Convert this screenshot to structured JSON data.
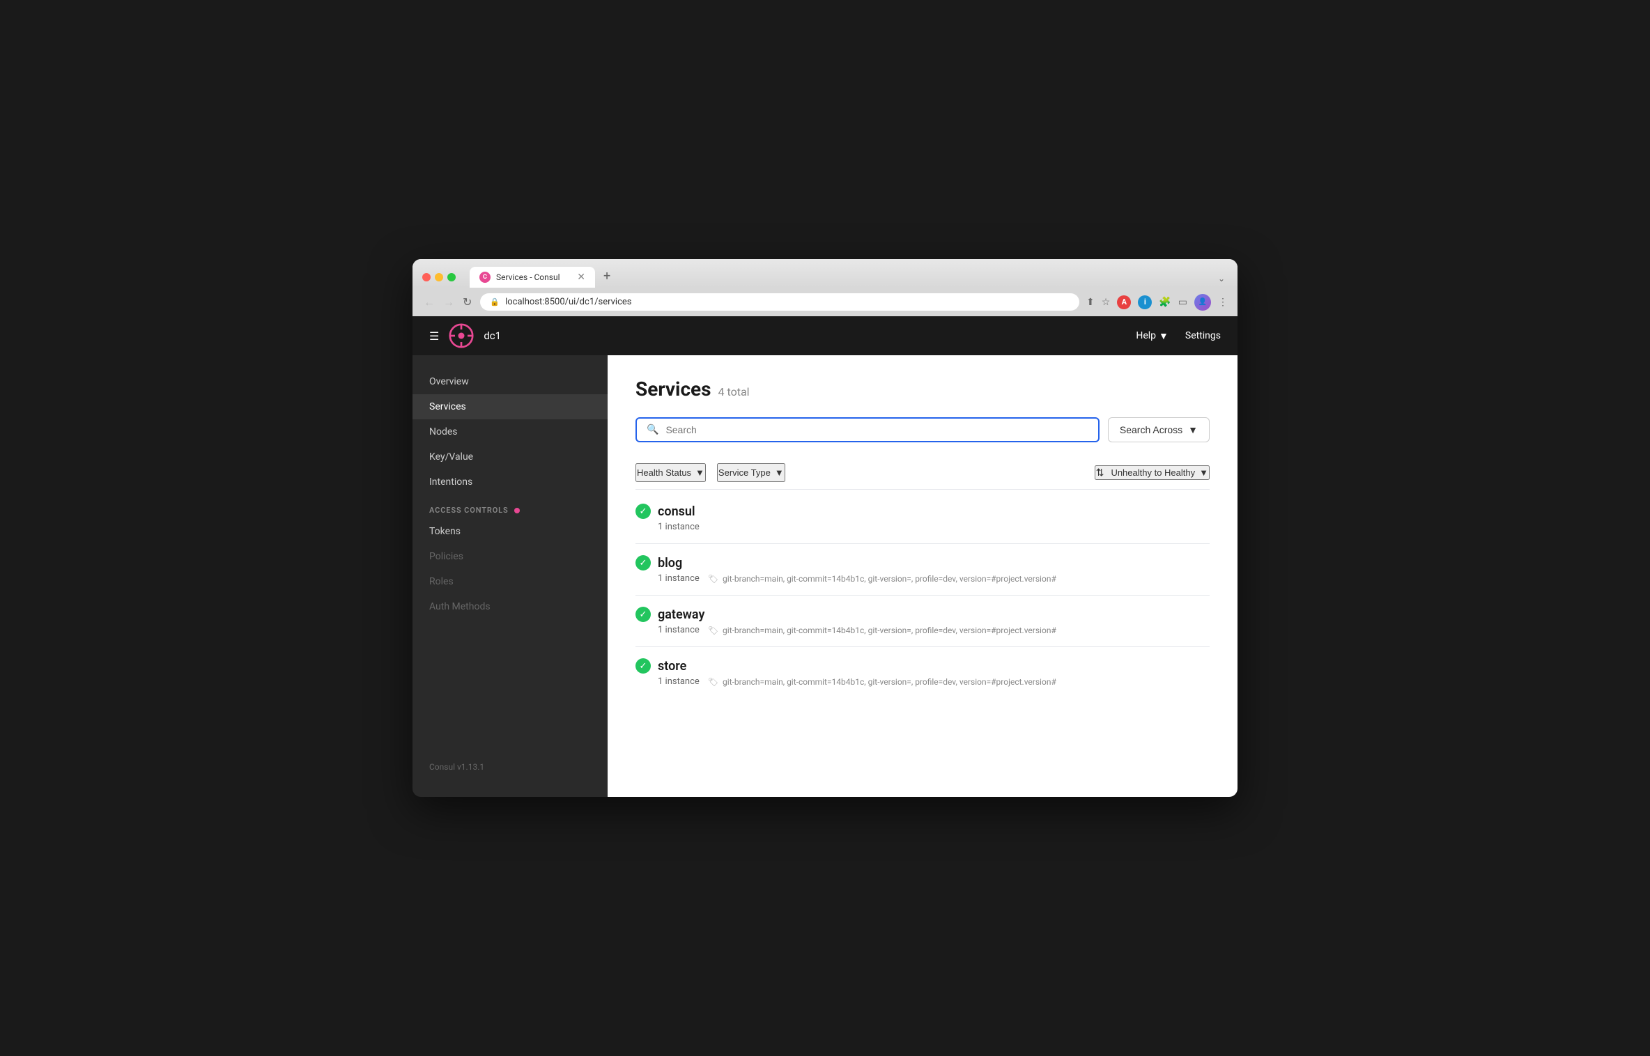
{
  "browser": {
    "tab_title": "Services - Consul",
    "url": "localhost:8500/ui/dc1/services",
    "new_tab_label": "+",
    "dropdown_label": "⌄"
  },
  "topbar": {
    "dc_name": "dc1",
    "help_label": "Help",
    "settings_label": "Settings"
  },
  "sidebar": {
    "items": [
      {
        "id": "overview",
        "label": "Overview",
        "active": false
      },
      {
        "id": "services",
        "label": "Services",
        "active": true
      },
      {
        "id": "nodes",
        "label": "Nodes",
        "active": false
      },
      {
        "id": "key-value",
        "label": "Key/Value",
        "active": false
      },
      {
        "id": "intentions",
        "label": "Intentions",
        "active": false
      }
    ],
    "access_controls_label": "ACCESS CONTROLS",
    "access_control_items": [
      {
        "id": "tokens",
        "label": "Tokens",
        "disabled": false
      },
      {
        "id": "policies",
        "label": "Policies",
        "disabled": true
      },
      {
        "id": "roles",
        "label": "Roles",
        "disabled": true
      },
      {
        "id": "auth-methods",
        "label": "Auth Methods",
        "disabled": true
      }
    ],
    "version": "Consul v1.13.1"
  },
  "main": {
    "page_title": "Services",
    "total_count": "4 total",
    "search_placeholder": "Search",
    "search_across_label": "Search Across",
    "filter_health_status": "Health Status",
    "filter_service_type": "Service Type",
    "sort_label": "Unhealthy to Healthy",
    "services": [
      {
        "name": "consul",
        "instances": "1 instance",
        "tags": "",
        "healthy": true
      },
      {
        "name": "blog",
        "instances": "1 instance",
        "tags": "git-branch=main, git-commit=14b4b1c, git-version=, profile=dev, version=#project.version#",
        "healthy": true
      },
      {
        "name": "gateway",
        "instances": "1 instance",
        "tags": "git-branch=main, git-commit=14b4b1c, git-version=, profile=dev, version=#project.version#",
        "healthy": true
      },
      {
        "name": "store",
        "instances": "1 instance",
        "tags": "git-branch=main, git-commit=14b4b1c, git-version=, profile=dev, version=#project.version#",
        "healthy": true
      }
    ]
  }
}
